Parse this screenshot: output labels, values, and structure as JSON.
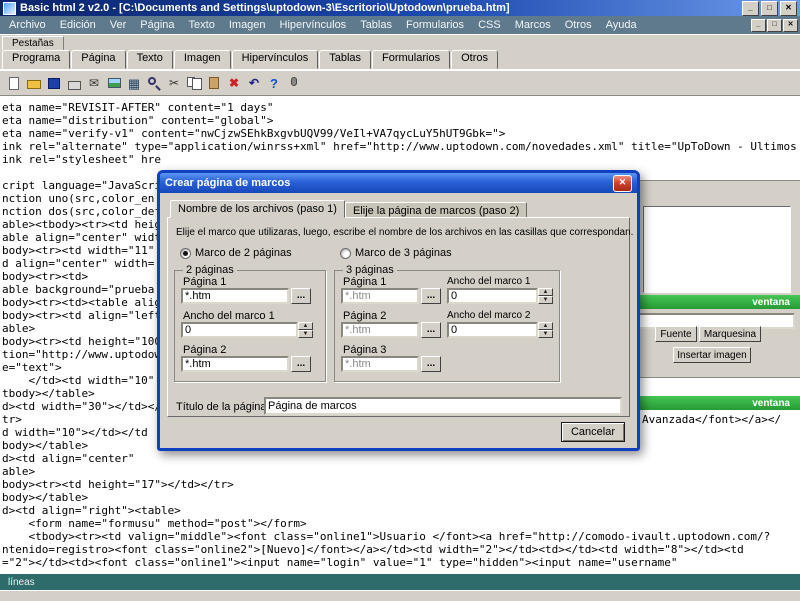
{
  "window": {
    "title": "Basic html 2 v2.0 - [C:\\Documents and Settings\\uptodown-3\\Escritorio\\Uptodown\\prueba.htm]",
    "controls": [
      {
        "name": "minimize-button",
        "glyph": "_"
      },
      {
        "name": "restore-button",
        "glyph": "□"
      },
      {
        "name": "close-button",
        "glyph": "✕"
      }
    ]
  },
  "menu": {
    "items": [
      "Archivo",
      "Edición",
      "Ver",
      "Página",
      "Texto",
      "Imagen",
      "Hipervínculos",
      "Tablas",
      "Formularios",
      "CSS",
      "Marcos",
      "Otros",
      "Ayuda"
    ],
    "child_controls": [
      {
        "name": "child-minimize-button",
        "glyph": "_"
      },
      {
        "name": "child-restore-button",
        "glyph": "□"
      },
      {
        "name": "child-close-button",
        "glyph": "✕"
      }
    ]
  },
  "pestanas_label": "Pestañas",
  "tabbar": {
    "items": [
      "Programa",
      "Página",
      "Texto",
      "Imagen",
      "Hipervínculos",
      "Tablas",
      "Formularios",
      "Otros"
    ]
  },
  "toolbar": {
    "icons": [
      {
        "name": "new-file-icon",
        "glyph": ""
      },
      {
        "name": "open-folder-icon",
        "glyph": ""
      },
      {
        "name": "save-icon",
        "glyph": ""
      },
      {
        "name": "print-icon",
        "glyph": ""
      },
      {
        "name": "email-icon",
        "glyph": "✉"
      },
      {
        "name": "image-icon",
        "glyph": ""
      },
      {
        "name": "table-icon",
        "glyph": "▦"
      },
      {
        "name": "search-icon",
        "glyph": ""
      },
      {
        "name": "cut-icon",
        "glyph": "✂"
      },
      {
        "name": "copy-icon",
        "glyph": ""
      },
      {
        "name": "paste-icon",
        "glyph": ""
      },
      {
        "name": "delete-icon",
        "glyph": "✖"
      },
      {
        "name": "undo-icon",
        "glyph": "↶"
      },
      {
        "name": "help-icon",
        "glyph": "?"
      },
      {
        "name": "microphone-icon",
        "glyph": ""
      }
    ]
  },
  "editor": {
    "lines": [
      "eta name=\"REVISIT-AFTER\" content=\"1 days\"",
      "eta name=\"distribution\" content=\"global\">",
      "eta name=\"verify-v1\" content=\"nwCjzwSEhkBxgvbUQV99/VeIl+VA7qycLuY5hUT9Gbk=\">",
      "ink rel=\"alternate\" type=\"application/winrss+xml\" href=\"http://www.uptodown.com/novedades.xml\" title=\"UpToDown - Ultimos programas\">",
      "ink rel=\"stylesheet\" hre",
      "",
      "cript language=\"JavaScri",
      "nction uno(src,color_en",
      "nction dos(src,color_def",
      "able><tbody><tr><td heig",
      "able align=\"center\" widt",
      "body><tr><td width=\"11\"",
      "d align=\"center\" width=",
      "body><tr><td>",
      "able background=\"prueba",
      "body><tr><td><table alig",
      "body><tr><td align=\"left",
      "able>",
      "body><tr><td height=\"100",
      "tion=\"http://www.uptodow",
      "e=\"text\">",
      "    </td><td width=\"10\"",
      "tbody></table>",
      "d><td width=\"30\"></td></",
      "tr>",
      "d width=\"10\"></td></td",
      "body></table>",
      "d><td align=\"center\"",
      "able>",
      "body><tr><td height=\"17\"></td></tr>",
      "body></table>",
      "d><td align=\"right\"><table>",
      "    <form name=\"formusu\" method=\"post\"></form>",
      "    <tbody><tr><td valign=\"middle\"><font class=\"online1\">Usuario </font><a href=\"http://comodo-ivault.uptodown.com/?",
      "ntenido=registro><font class=\"online2\">[Nuevo]</font></a></td><td width=\"2\"></td><td></td><td width=\"8\"></td><td",
      "=\"2\"></td><td><font class=\"online1\"><input name=\"login\" value=\"1\" type=\"hidden\"><input name=\"username\""
    ],
    "right_fragment": "Avanzada</font></a></"
  },
  "dialog": {
    "title": "Crear página de marcos",
    "close_glyph": "✕",
    "tabs": [
      {
        "label": "Nombre de los archivos (paso 1)",
        "active": true
      },
      {
        "label": "Elije la página de marcos (paso 2)",
        "active": false
      }
    ],
    "instruction": "Elije el marco que utilizaras, luego, escribe el nombre de los archivos en las casillas que correspondan.",
    "radio_two_label": "Marco de 2 páginas",
    "radio_three_label": "Marco de 3 páginas",
    "browse_label": "...",
    "spin_up": "▲",
    "spin_down": "▼",
    "group_two": {
      "title": "2 páginas",
      "page1_label": "Página 1",
      "page1_value": "*.htm",
      "width1_label": "Ancho del marco 1",
      "width1_value": "0",
      "page2_label": "Página 2",
      "page2_value": "*.htm"
    },
    "group_three": {
      "title": "3 páginas",
      "page1_label": "Página 1",
      "page1_value": "*.htm",
      "width1_label": "Ancho del marco 1",
      "width1_value": "0",
      "page2_label": "Página 2",
      "page2_value": "*.htm",
      "width2_label": "Ancho del marco 2",
      "width2_value": "0",
      "page3_label": "Página 3",
      "page3_value": "*.htm"
    },
    "page_title_label": "Título de la página",
    "page_title_value": "Página de marcos",
    "cancel_label": "Cancelar"
  },
  "side_panel": {
    "header1": "ventana",
    "input_value": "",
    "font_button": "Fuente",
    "marquee_button": "Marquesina",
    "insert_image_button": "Insertar imagen",
    "header2": "ventana"
  },
  "statusbar": {
    "text": "líneas"
  },
  "colors": {
    "titlebar_blue": "#0a246a",
    "menu_bar": "#5e7a8c",
    "panel_green": "#2fae3e",
    "status_teal": "#2e6b6b",
    "dialog_title_blue": "#1c55d4"
  }
}
